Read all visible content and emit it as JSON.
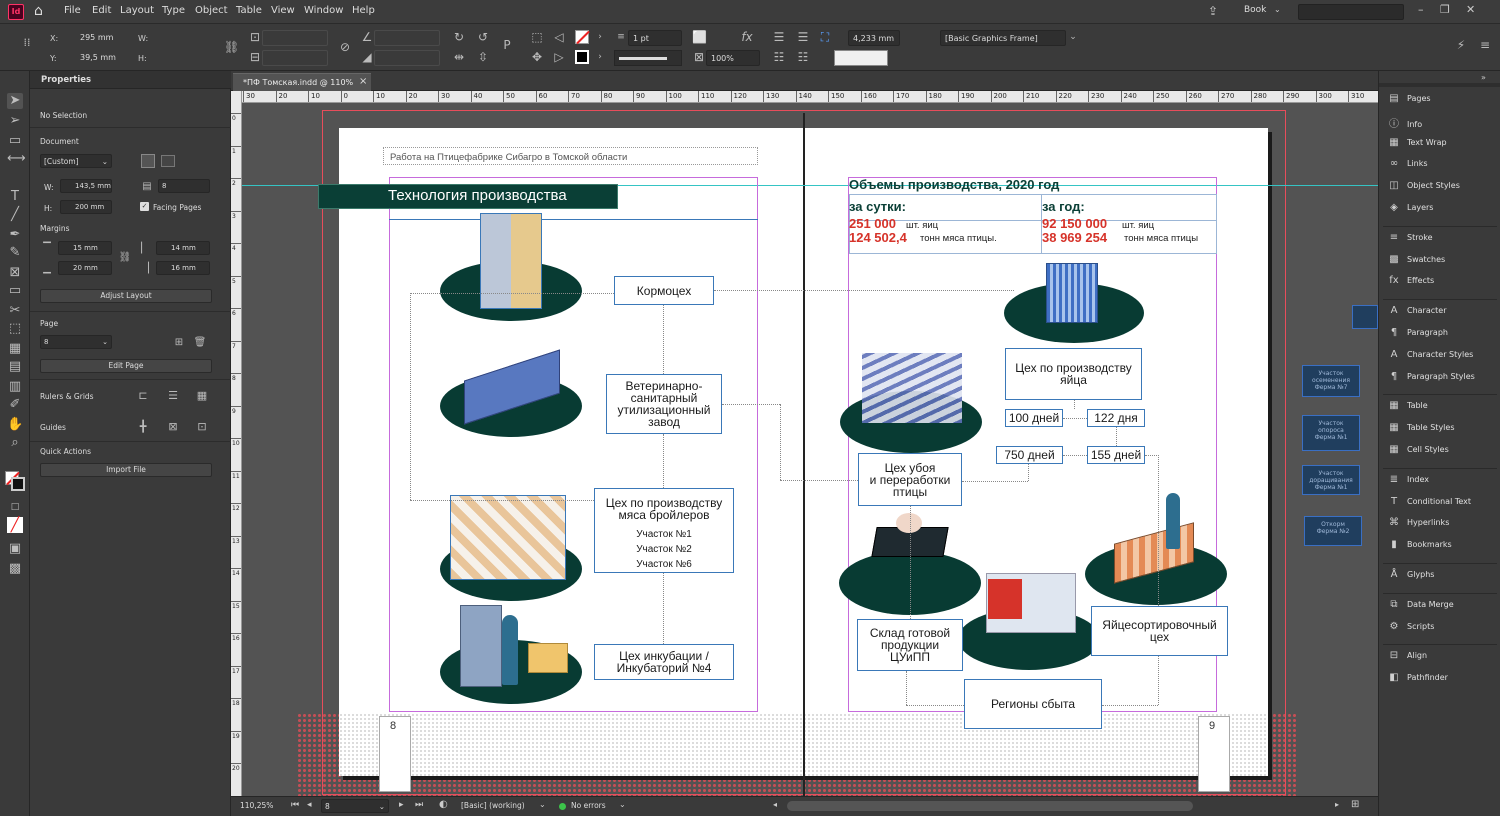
{
  "app": {
    "logo": "Id",
    "workspace": "Book"
  },
  "menu": [
    "File",
    "Edit",
    "Layout",
    "Type",
    "Object",
    "Table",
    "View",
    "Window",
    "Help"
  ],
  "control": {
    "x_label": "X:",
    "x": "295 mm",
    "y_label": "Y:",
    "y": "39,5 mm",
    "w_label": "W:",
    "h_label": "H:",
    "stroke_weight": "1 pt",
    "scale": "100%",
    "ref_value": "4,233 mm",
    "object_style": "[Basic Graphics Frame]"
  },
  "properties": {
    "title": "Properties",
    "selection": "No Selection",
    "document_label": "Document",
    "preset": "[Custom]",
    "w_label": "W:",
    "w": "143,5 mm",
    "h_label": "H:",
    "h": "200 mm",
    "pages": "8",
    "facing_pages": "Facing Pages",
    "margins_label": "Margins",
    "m_top": "15 mm",
    "m_bottom": "20 mm",
    "m_inside": "14 mm",
    "m_outside": "16 mm",
    "adjust_layout": "Adjust Layout",
    "page_label": "Page",
    "page_value": "8",
    "edit_page": "Edit Page",
    "rulers_grids": "Rulers & Grids",
    "guides": "Guides",
    "quick_actions": "Quick Actions",
    "import_file": "Import File"
  },
  "doc_tab": {
    "title": "*ПФ Томская.indd @ 110%",
    "close": "×"
  },
  "hruler": [
    "30",
    "20",
    "10",
    "0",
    "10",
    "20",
    "30",
    "40",
    "50",
    "60",
    "70",
    "80",
    "90",
    "100",
    "110",
    "120",
    "130",
    "140",
    "150",
    "160",
    "170",
    "180",
    "190",
    "200",
    "210",
    "220",
    "230",
    "240",
    "250",
    "260",
    "270",
    "280",
    "290",
    "300",
    "310"
  ],
  "vruler": [
    "0",
    "1",
    "2",
    "3",
    "4",
    "5",
    "6",
    "7",
    "8",
    "9",
    "10",
    "11",
    "12",
    "13",
    "14",
    "15",
    "16",
    "17",
    "18",
    "19",
    "20"
  ],
  "page": {
    "header": "Работа на Птицефабрике Сибагро в Томской области",
    "left_title": "Технология производства",
    "right_title": "Объемы производства, 2020 год",
    "per_day_label": "за сутки:",
    "per_day_eggs": "251 000",
    "per_day_eggs_unit": "шт. яиц",
    "per_day_meat": "124 502,4",
    "per_day_meat_unit": "тонн мяса птицы.",
    "per_year_label": "за год:",
    "per_year_eggs": "92 150 000",
    "per_year_eggs_unit": "шт. яиц",
    "per_year_meat": "38 969 254",
    "per_year_meat_unit": "тонн мяса птицы",
    "feed_mill": "Кормоцех",
    "vet_plant_1": "Ветеринарно-",
    "vet_plant_2": "санитарный",
    "vet_plant_3": "утилизационный",
    "vet_plant_4": "завод",
    "broiler_1": "Цех по производству",
    "broiler_2": "мяса бройлеров",
    "site1": "Участок №1",
    "site2": "Участок №2",
    "site6": "Участок №6",
    "incubation_1": "Цех инкубации /",
    "incubation_2": "Инкубаторий №4",
    "egg_shop_1": "Цех по производству",
    "egg_shop_2": "яйца",
    "days100": "100 дней",
    "days122": "122 дня",
    "days750": "750 дней",
    "days155": "155 дней",
    "slaughter_1": "Цех убоя",
    "slaughter_2": "и переработки",
    "slaughter_3": "птицы",
    "warehouse_1": "Склад готовой",
    "warehouse_2": "продукции",
    "warehouse_3": "ЦУиПП",
    "egg_sort_1": "Яйцесортировочный",
    "egg_sort_2": "цех",
    "sales": "Регионы сбыта",
    "page_left": "8",
    "page_right": "9"
  },
  "pasteboard": [
    {
      "l1": "Участок",
      "l2": "осеменения",
      "l3": "Ферма №7"
    },
    {
      "l1": "Участок",
      "l2": "опороса",
      "l3": "Ферма №1"
    },
    {
      "l1": "Участок",
      "l2": "доращивания",
      "l3": "Ферма №1"
    },
    {
      "l1": "Откорм",
      "l2": "Ферма №2"
    }
  ],
  "status": {
    "zoom": "110,25%",
    "page": "8",
    "style": "[Basic] (working)",
    "errors": "No errors"
  },
  "right_panel": [
    {
      "icon": "▤",
      "label": "Pages"
    },
    {
      "icon": "ⓘ",
      "label": "Info"
    },
    {
      "icon": "▦",
      "label": "Text Wrap"
    },
    {
      "icon": "∞",
      "label": "Links"
    },
    {
      "icon": "◫",
      "label": "Object Styles"
    },
    {
      "icon": "◈",
      "label": "Layers"
    },
    {
      "icon": "≡",
      "label": "Stroke"
    },
    {
      "icon": "▩",
      "label": "Swatches"
    },
    {
      "icon": "fx",
      "label": "Effects"
    },
    {
      "icon": "A",
      "label": "Character"
    },
    {
      "icon": "¶",
      "label": "Paragraph"
    },
    {
      "icon": "A",
      "label": "Character Styles"
    },
    {
      "icon": "¶",
      "label": "Paragraph Styles"
    },
    {
      "icon": "▦",
      "label": "Table"
    },
    {
      "icon": "▦",
      "label": "Table Styles"
    },
    {
      "icon": "▦",
      "label": "Cell Styles"
    },
    {
      "icon": "≣",
      "label": "Index"
    },
    {
      "icon": "T",
      "label": "Conditional Text"
    },
    {
      "icon": "⌘",
      "label": "Hyperlinks"
    },
    {
      "icon": "▮",
      "label": "Bookmarks"
    },
    {
      "icon": "Å",
      "label": "Glyphs"
    },
    {
      "icon": "⧉",
      "label": "Data Merge"
    },
    {
      "icon": "⚙",
      "label": "Scripts"
    },
    {
      "icon": "⊟",
      "label": "Align"
    },
    {
      "icon": "◧",
      "label": "Pathfinder"
    }
  ],
  "colors": {
    "dark_green": "#083b33",
    "red": "#d6332a",
    "frame": "#c66bdc",
    "blue_box": "#3a78b8"
  }
}
